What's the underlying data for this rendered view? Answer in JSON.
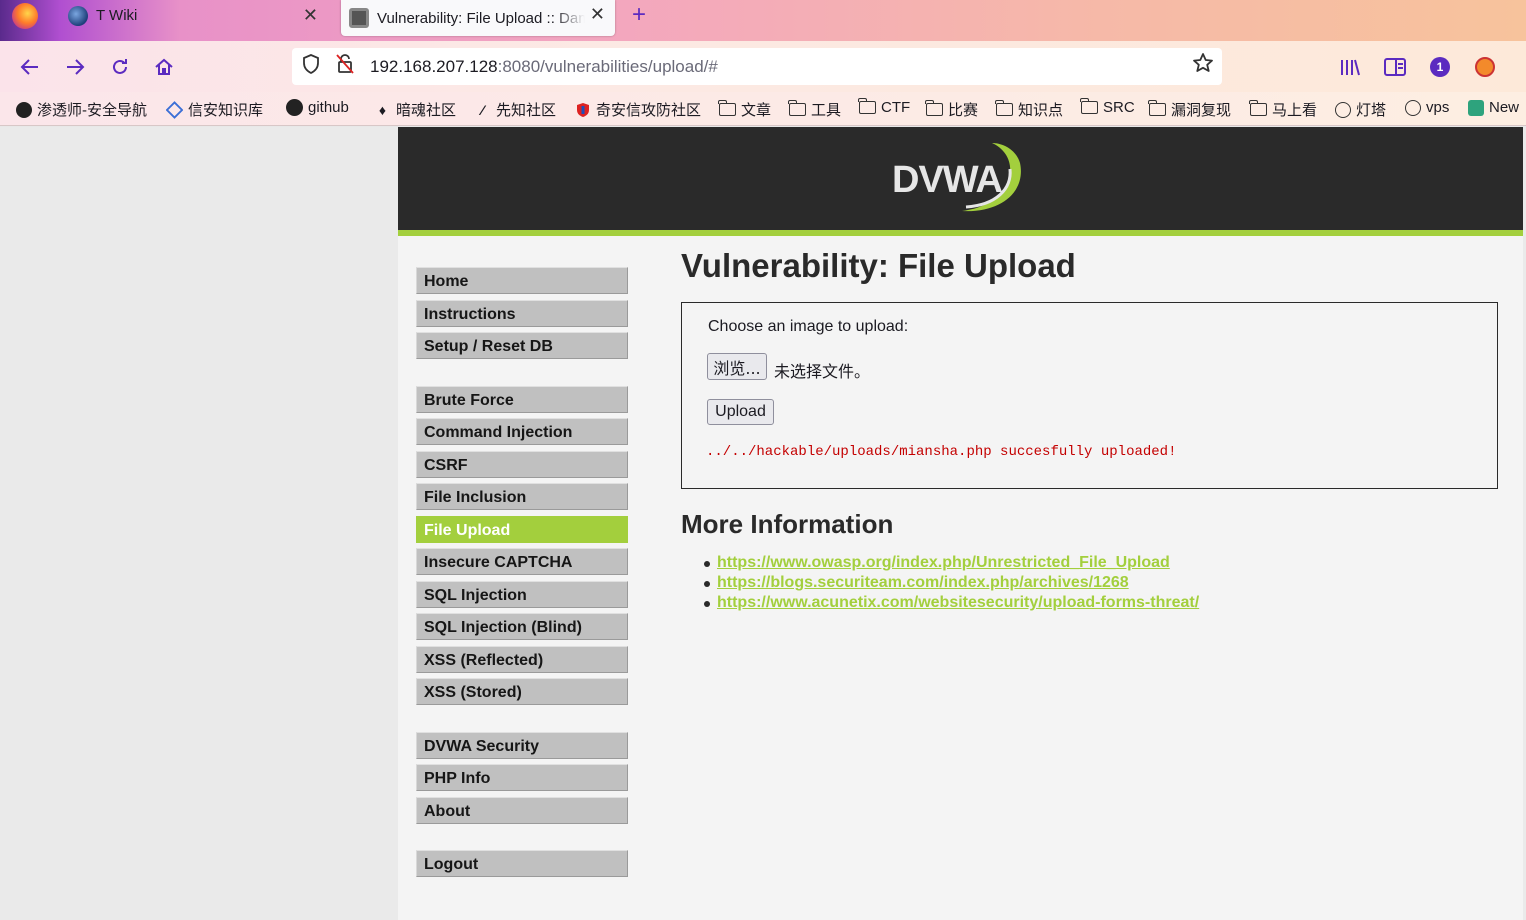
{
  "browser": {
    "tabs": [
      {
        "title": "T Wiki",
        "active": false
      },
      {
        "title": "Vulnerability: File Upload :: Damn Vulnerable Web Application (DVWA)",
        "active": true
      }
    ],
    "tab_close_glyph": "✕",
    "new_tab_glyph": "+",
    "url_host": "192.168.207.128",
    "url_rest": ":8080/vulnerabilities/upload/#",
    "toolbar_badge": "1",
    "bookmarks": [
      {
        "label": "渗透师-安全导航",
        "icon": "ghost-icon"
      },
      {
        "label": "信安知识库",
        "icon": "diamond-icon"
      },
      {
        "label": "github",
        "icon": "github-icon"
      },
      {
        "label": "暗魂社区",
        "icon": "flame-icon"
      },
      {
        "label": "先知社区",
        "icon": "slash-icon"
      },
      {
        "label": "奇安信攻防社区",
        "icon": "shield-icon"
      },
      {
        "label": "文章",
        "icon": "folder-icon"
      },
      {
        "label": "工具",
        "icon": "folder-icon"
      },
      {
        "label": "CTF",
        "icon": "folder-icon"
      },
      {
        "label": "比赛",
        "icon": "folder-icon"
      },
      {
        "label": "知识点",
        "icon": "folder-icon"
      },
      {
        "label": "SRC",
        "icon": "folder-icon"
      },
      {
        "label": "漏洞复现",
        "icon": "folder-icon"
      },
      {
        "label": "马上看",
        "icon": "folder-icon"
      },
      {
        "label": "灯塔",
        "icon": "globe-icon"
      },
      {
        "label": "vps",
        "icon": "globe-icon"
      },
      {
        "label": "New",
        "icon": "openai-icon"
      }
    ]
  },
  "dvwa": {
    "logo": "DVWA",
    "menu": {
      "group1": [
        "Home",
        "Instructions",
        "Setup / Reset DB"
      ],
      "group2": [
        "Brute Force",
        "Command Injection",
        "CSRF",
        "File Inclusion",
        "File Upload",
        "Insecure CAPTCHA",
        "SQL Injection",
        "SQL Injection (Blind)",
        "XSS (Reflected)",
        "XSS (Stored)"
      ],
      "group3": [
        "DVWA Security",
        "PHP Info",
        "About"
      ],
      "group4": [
        "Logout"
      ],
      "selected": "File Upload"
    },
    "page_title": "Vulnerability: File Upload",
    "upload_form": {
      "prompt": "Choose an image to upload:",
      "browse_label": "浏览...",
      "no_file_text": "未选择文件。",
      "upload_label": "Upload",
      "result": "../../hackable/uploads/miansha.php succesfully uploaded!"
    },
    "more_info_title": "More Information",
    "links": [
      "https://www.owasp.org/index.php/Unrestricted_File_Upload",
      "https://blogs.securiteam.com/index.php/archives/1268",
      "https://www.acunetix.com/websitesecurity/upload-forms-threat/"
    ]
  },
  "colors": {
    "accent_green": "#a3cf3d",
    "header_dark": "#2a2a2a",
    "error_red": "#c40000",
    "browser_purple": "#5b2bc0"
  }
}
